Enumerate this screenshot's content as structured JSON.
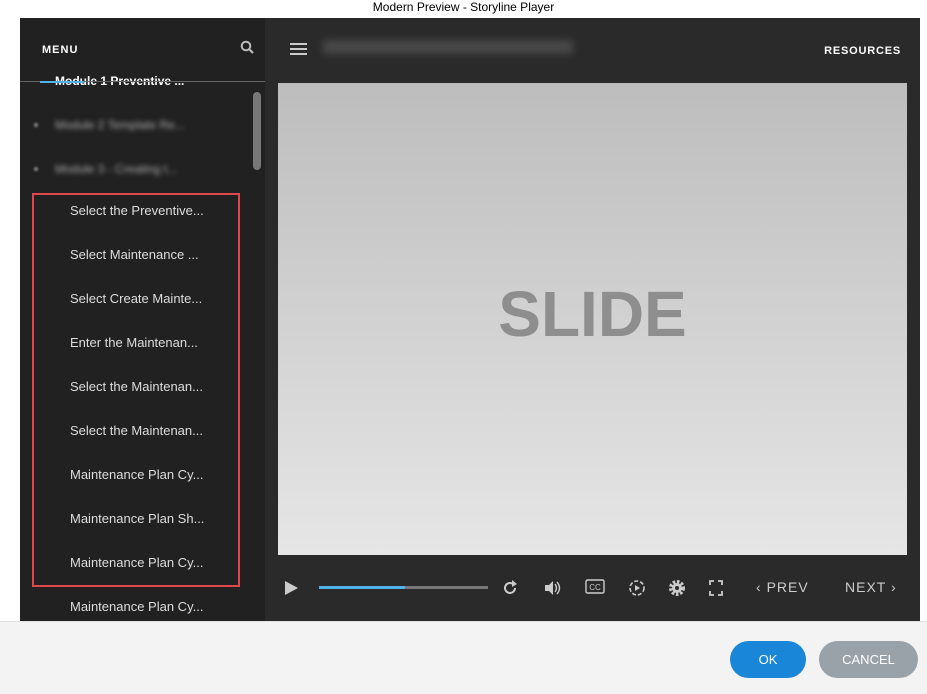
{
  "window_title": "Modern Preview - Storyline Player",
  "sidebar": {
    "menu_label": "MENU",
    "modules": [
      "Module 1 Preventive ...",
      "Module 2 Template Re...",
      "Module 3 - Creating t..."
    ],
    "items": [
      "Select the Preventive...",
      "Select Maintenance ...",
      "Select Create Mainte...",
      "Enter the Maintenan...",
      "Select the Maintenan...",
      "Select the Maintenan...",
      "Maintenance Plan Cy...",
      "Maintenance Plan Sh...",
      "Maintenance Plan Cy...",
      "Maintenance Plan Cy..."
    ]
  },
  "header": {
    "resources_label": "RESOURCES"
  },
  "slide": {
    "text": "SLIDE"
  },
  "controls": {
    "progress_percent": 51,
    "prev_label": "PREV",
    "next_label": "NEXT"
  },
  "footer": {
    "ok_label": "OK",
    "cancel_label": "CANCEL"
  },
  "colors": {
    "accent": "#4fb3ea",
    "highlight": "#e0474c",
    "ok": "#1a86d8"
  }
}
